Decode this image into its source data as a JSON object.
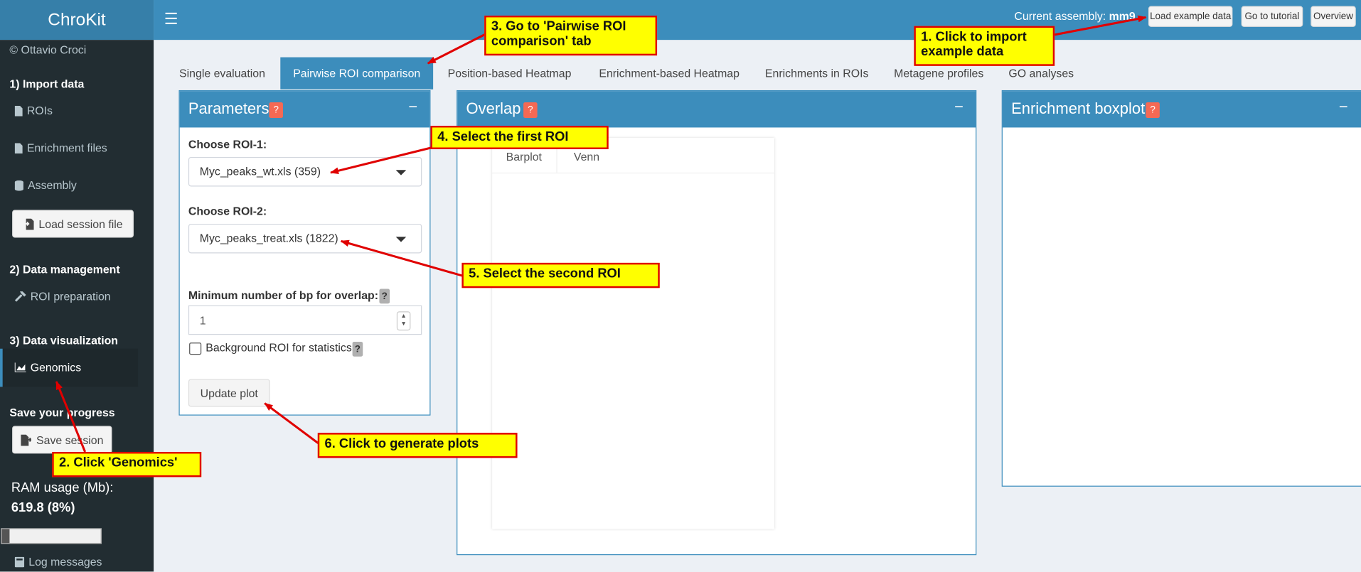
{
  "app": {
    "logo": "ChroKit",
    "menu_icon": "hamburger-icon"
  },
  "header": {
    "assembly_label": "Current assembly:",
    "assembly_value": "mm9",
    "buttons": [
      "Load example data",
      "Go to tutorial",
      "Overview"
    ]
  },
  "sidebar": {
    "author": "© Ottavio Croci",
    "section1": "1) Import data",
    "rois": "ROIs",
    "enrichment": "Enrichment files",
    "assembly": "Assembly",
    "load_session": "Load session file",
    "section2": "2) Data management",
    "roi_prep": "ROI preparation",
    "section3": "3) Data visualization",
    "genomics": "Genomics",
    "save_progress": "Save your progress",
    "save_session": "Save session",
    "ram_label": "RAM usage (Mb):",
    "ram_value": "619.8 (8%)",
    "ram_fraction": 0.08,
    "log": "Log messages"
  },
  "tabs": [
    "Single evaluation",
    "Pairwise ROI comparison",
    "Position-based Heatmap",
    "Enrichment-based Heatmap",
    "Enrichments in ROIs",
    "Metagene profiles",
    "GO analyses"
  ],
  "active_tab": "Pairwise ROI comparison",
  "parameters": {
    "title": "Parameters",
    "help": "?",
    "collapse": "−",
    "roi1_label": "Choose ROI-1:",
    "roi1_value": "Myc_peaks_wt.xls (359)",
    "roi2_label": "Choose ROI-2:",
    "roi2_value": "Myc_peaks_treat.xls (1822)",
    "min_bp_label": "Minimum number of bp for overlap:",
    "min_bp_value": "1",
    "background_label": "Background ROI for statistics",
    "update_button": "Update plot"
  },
  "overlap": {
    "title": "Overlap",
    "help": "?",
    "collapse": "−",
    "tabs": [
      "Barplot",
      "Venn"
    ]
  },
  "boxplot": {
    "title": "Enrichment boxplot",
    "help": "?",
    "collapse": "−"
  },
  "annotations": {
    "a1": "1. Click to import\nexample data",
    "a2": "2. Click 'Genomics'",
    "a3": "3. Go to 'Pairwise ROI\ncomparison' tab",
    "a4": "4. Select the first ROI",
    "a5": "5. Select the second ROI",
    "a6": "6. Click to generate plots"
  },
  "colors": {
    "header": "#3c8dbc",
    "logo": "#367fa9",
    "sidebar": "#222d32",
    "annotation_bg": "#ffff00",
    "annotation_border": "#e00000"
  }
}
